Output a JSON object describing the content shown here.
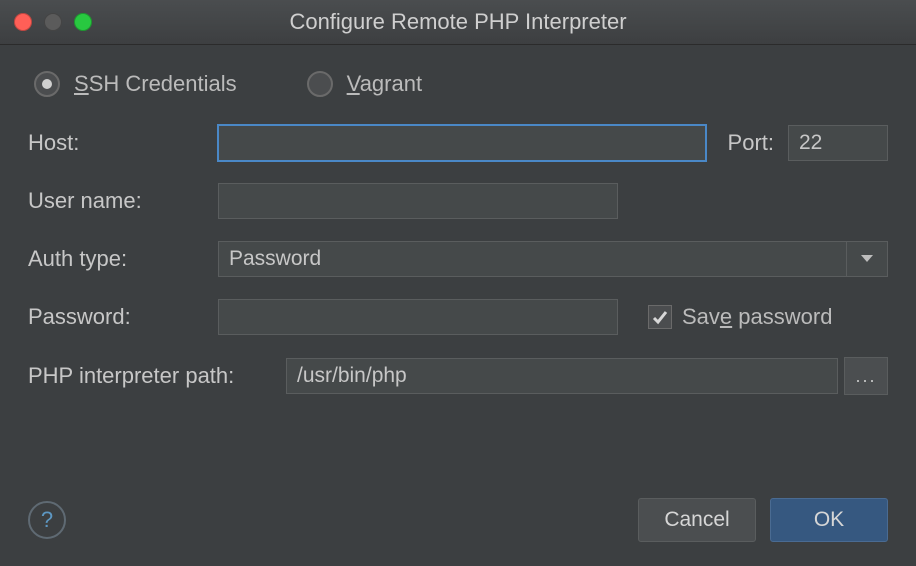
{
  "title": "Configure Remote PHP Interpreter",
  "connection_type": {
    "selected": "ssh",
    "ssh_label_pre": "S",
    "ssh_label_post": "SH Credentials",
    "vagrant_label_pre": "V",
    "vagrant_label_post": "agrant"
  },
  "fields": {
    "host_label": "Host:",
    "host_value": "",
    "port_label": "Port:",
    "port_value": "22",
    "user_label": "User name:",
    "user_value": "",
    "auth_label": "Auth type:",
    "auth_value": "Password",
    "password_label": "Password:",
    "password_value": "",
    "save_pw_pre": "Sav",
    "save_pw_u": "e",
    "save_pw_post": " password",
    "save_pw_checked": true,
    "path_label": "PHP interpreter path:",
    "path_value": "/usr/bin/php",
    "browse_label": "..."
  },
  "footer": {
    "help": "?",
    "cancel": "Cancel",
    "ok": "OK"
  }
}
